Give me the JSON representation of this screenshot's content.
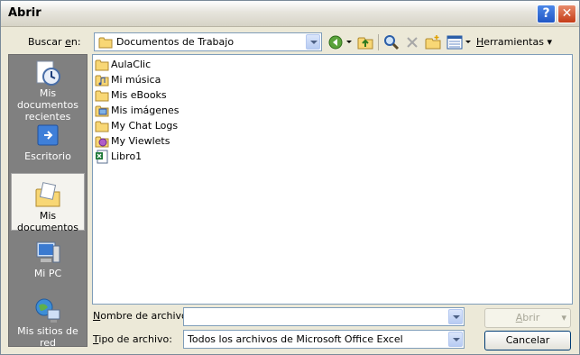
{
  "window": {
    "title": "Abrir"
  },
  "toolbar": {
    "look_in_label": "Buscar en:",
    "location": "Documentos de Trabajo",
    "tools_label": "Herramientas"
  },
  "places": [
    {
      "label": "Mis documentos recientes",
      "icon": "recent-documents-icon"
    },
    {
      "label": "Escritorio",
      "icon": "desktop-icon"
    },
    {
      "label": "Mis documentos",
      "icon": "my-documents-icon",
      "selected": true
    },
    {
      "label": "Mi PC",
      "icon": "my-computer-icon"
    },
    {
      "label": "Mis sitios de red",
      "icon": "network-places-icon"
    }
  ],
  "files": [
    {
      "name": "AulaClic",
      "icon": "folder-icon"
    },
    {
      "name": "Mi música",
      "icon": "music-folder-icon"
    },
    {
      "name": "Mis eBooks",
      "icon": "folder-icon"
    },
    {
      "name": "Mis imágenes",
      "icon": "pictures-folder-icon"
    },
    {
      "name": "My Chat Logs",
      "icon": "folder-icon"
    },
    {
      "name": "My Viewlets",
      "icon": "viewlets-folder-icon"
    },
    {
      "name": "Libro1",
      "icon": "excel-file-icon"
    }
  ],
  "form": {
    "filename_label": "Nombre de archivo:",
    "filename_value": "",
    "filetype_label": "Tipo de archivo:",
    "filetype_value": "Todos los archivos de Microsoft Office Excel"
  },
  "buttons": {
    "open": "Abrir",
    "cancel": "Cancelar"
  }
}
